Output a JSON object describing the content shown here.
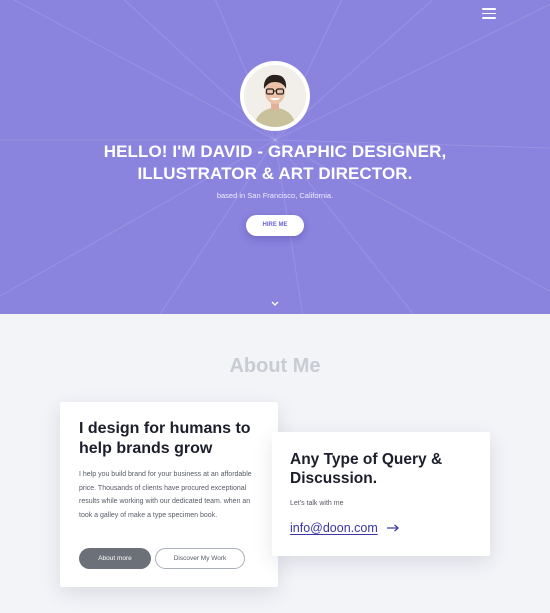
{
  "hero": {
    "title": "HELLO! I'M DAVID - GRAPHIC DESIGNER, ILLUSTRATOR & ART DIRECTOR.",
    "subtitle": "based in San Francisco, California.",
    "hire_label": "HIRE ME",
    "background_color": "#8a84df"
  },
  "icons": {
    "menu": "hamburger-menu-icon",
    "scroll": "chevron-down-icon",
    "arrow": "arrow-right-icon"
  },
  "about": {
    "heading": "About Me",
    "card_left": {
      "title": "I design for humans to help brands grow",
      "body": "I help you build brand for your business at an affordable price. Thousands of clients have procured exceptional results while working with our dedicated team. when an took a galley of make a type specimen book.",
      "primary_button": "About more",
      "secondary_button": "Discover My Work"
    },
    "card_right": {
      "title": "Any Type of Query & Discussion.",
      "talk_text": "Let's talk with me",
      "email": "info@doon.com"
    }
  }
}
